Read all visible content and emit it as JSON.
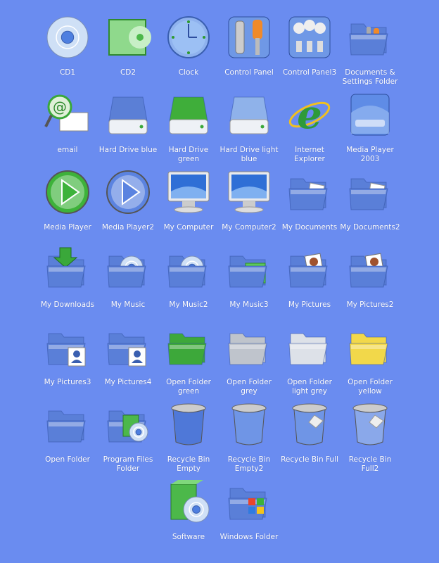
{
  "background": "#6a8cf0",
  "icons": [
    {
      "label": "CD1",
      "kind": "cd"
    },
    {
      "label": "CD2",
      "kind": "cdcase"
    },
    {
      "label": "Clock",
      "kind": "clock"
    },
    {
      "label": "Control Panel",
      "kind": "tools"
    },
    {
      "label": "Control Panel3",
      "kind": "panel"
    },
    {
      "label": "Documents & Settings Folder",
      "kind": "folder",
      "color": "#5a7fd8",
      "overlay": "tools"
    },
    {
      "label": "email",
      "kind": "mail"
    },
    {
      "label": "Hard Drive blue",
      "kind": "drive",
      "color": "#5b7fd6"
    },
    {
      "label": "Hard Drive green",
      "kind": "drive",
      "color": "#3fae3a"
    },
    {
      "label": "Hard Drive light blue",
      "kind": "drive",
      "color": "#8fb2ea"
    },
    {
      "label": "Internet Explorer",
      "kind": "ie"
    },
    {
      "label": "Media Player 2003",
      "kind": "media"
    },
    {
      "label": "Media Player",
      "kind": "play",
      "color": "#3db23a"
    },
    {
      "label": "Media Player2",
      "kind": "play",
      "color": "#5b83e0"
    },
    {
      "label": "My Computer",
      "kind": "monitor"
    },
    {
      "label": "My Computer2",
      "kind": "monitor"
    },
    {
      "label": "My Documents",
      "kind": "folder",
      "color": "#5a7fd8",
      "overlay": "paper"
    },
    {
      "label": "My Documents2",
      "kind": "folder",
      "color": "#5a7fd8",
      "overlay": "paper"
    },
    {
      "label": "My Downloads",
      "kind": "folder",
      "color": "#5a7fd8",
      "overlay": "arrow"
    },
    {
      "label": "My Music",
      "kind": "folder",
      "color": "#5a7fd8",
      "overlay": "cd"
    },
    {
      "label": "My Music2",
      "kind": "folder",
      "color": "#5a7fd8",
      "overlay": "cd"
    },
    {
      "label": "My Music3",
      "kind": "folder",
      "color": "#5a7fd8",
      "overlay": "cdcase"
    },
    {
      "label": "My Pictures",
      "kind": "folder",
      "color": "#5a7fd8",
      "overlay": "photo"
    },
    {
      "label": "My Pictures2",
      "kind": "folder",
      "color": "#5a7fd8",
      "overlay": "photo"
    },
    {
      "label": "My Pictures3",
      "kind": "folder",
      "color": "#5a7fd8",
      "overlay": "person"
    },
    {
      "label": "My Pictures4",
      "kind": "folder",
      "color": "#5a7fd8",
      "overlay": "person"
    },
    {
      "label": "Open Folder green",
      "kind": "folder",
      "color": "#3da83a"
    },
    {
      "label": "Open Folder grey",
      "kind": "folder",
      "color": "#bfc4cc"
    },
    {
      "label": "Open Folder light grey",
      "kind": "folder",
      "color": "#dde1e8"
    },
    {
      "label": "Open Folder yellow",
      "kind": "folder",
      "color": "#f2d84a"
    },
    {
      "label": "Open Folder",
      "kind": "folder",
      "color": "#5a7fd8"
    },
    {
      "label": "Program Files Folder",
      "kind": "folder",
      "color": "#5a7fd8",
      "overlay": "box"
    },
    {
      "label": "Recycle Bin Empty",
      "kind": "bin",
      "color": "#4f78d8"
    },
    {
      "label": "Recycle Bin Empty2",
      "kind": "bin",
      "color": "#6f95e6"
    },
    {
      "label": "Recycle Bin Full",
      "kind": "bin",
      "color": "#6f95e6",
      "full": true
    },
    {
      "label": "Recycle Bin Full2",
      "kind": "bin",
      "color": "#8aa8ea",
      "full": true
    },
    {
      "label": "",
      "kind": "none"
    },
    {
      "label": "",
      "kind": "none"
    },
    {
      "label": "Software",
      "kind": "box"
    },
    {
      "label": "Windows Folder",
      "kind": "folder",
      "color": "#5a7fd8",
      "overlay": "windows"
    }
  ]
}
